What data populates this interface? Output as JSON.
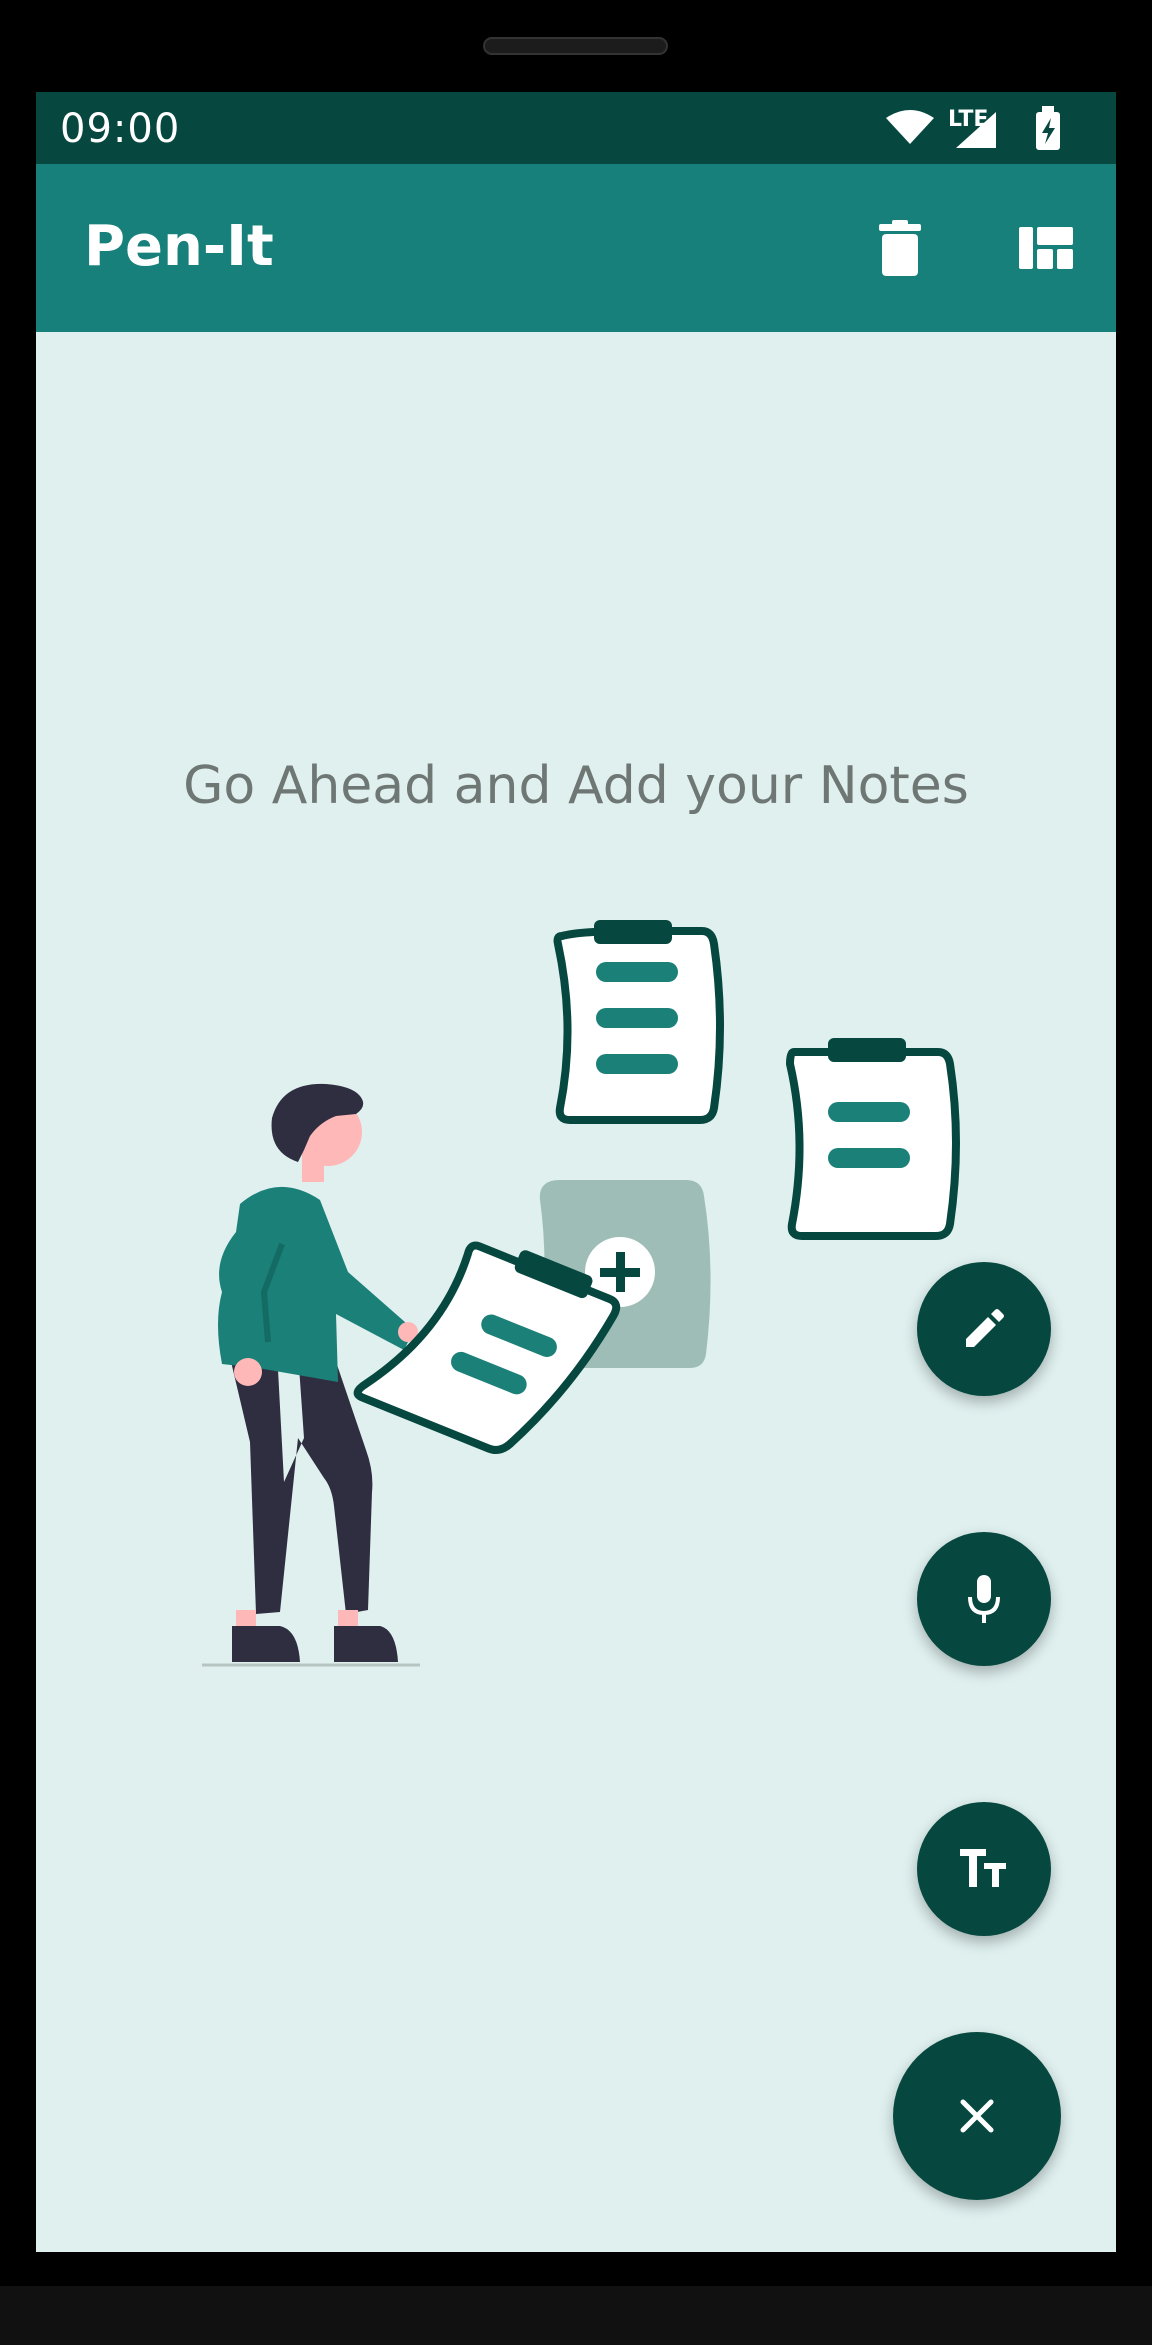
{
  "status_bar": {
    "time": "09:00",
    "network_label": "LTE",
    "icons": [
      "wifi-icon",
      "signal-icon",
      "battery-charging-icon"
    ]
  },
  "app_bar": {
    "title": "Pen-It",
    "actions": [
      "delete-icon",
      "layout-toggle-icon"
    ]
  },
  "empty_state": {
    "message": "Go Ahead and Add your Notes"
  },
  "fab_menu": {
    "items": [
      "edit-icon",
      "mic-icon",
      "text-format-icon"
    ],
    "main": "close-icon"
  },
  "colors": {
    "status_bar": "#06483f",
    "app_bar": "#18807a",
    "background": "#dff0ef",
    "fab": "#06483f",
    "accent": "#1b8078"
  }
}
